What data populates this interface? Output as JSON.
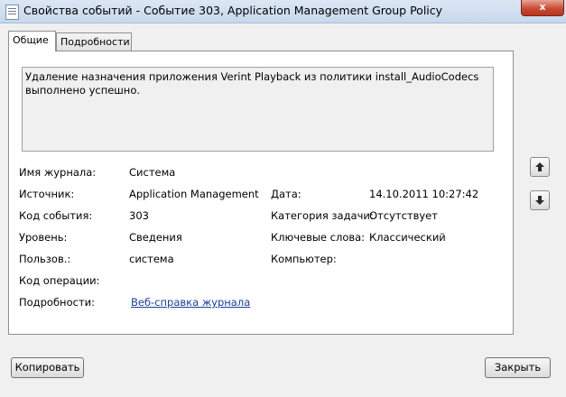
{
  "window": {
    "title": "Свойства событий - Событие 303, Application Management Group Policy",
    "close_glyph": "x"
  },
  "tabs": [
    {
      "label": "Общие",
      "active": true
    },
    {
      "label": "Подробности",
      "active": false
    }
  ],
  "description": {
    "line1": "Удаление назначения приложения Verint Playback из политики install_AudioCodecs",
    "line2": "выполнено успешно."
  },
  "fields": {
    "log_name": {
      "label": "Имя журнала:",
      "value": "Система"
    },
    "source": {
      "label": "Источник:",
      "value": "Application Management Gr"
    },
    "date": {
      "label": "Дата:",
      "value": "14.10.2011 10:27:42"
    },
    "event_code": {
      "label": "Код события:",
      "value": "303"
    },
    "task_category": {
      "label": "Категория задачи:",
      "value": "Отсутствует"
    },
    "level": {
      "label": "Уровень:",
      "value": "Сведения"
    },
    "keywords": {
      "label": "Ключевые слова:",
      "value": "Классический"
    },
    "user": {
      "label": "Пользов.:",
      "value": "система"
    },
    "computer": {
      "label": "Компьютер:",
      "value": ""
    },
    "op_code": {
      "label": "Код операции:",
      "value": ""
    },
    "details": {
      "label": "Подробности:",
      "link": "Веб-справка журнала"
    }
  },
  "buttons": {
    "copy": "Копировать",
    "close": "Закрыть"
  },
  "icons": {
    "scroll_up": "arrow-up-icon",
    "scroll_down": "arrow-down-icon"
  }
}
